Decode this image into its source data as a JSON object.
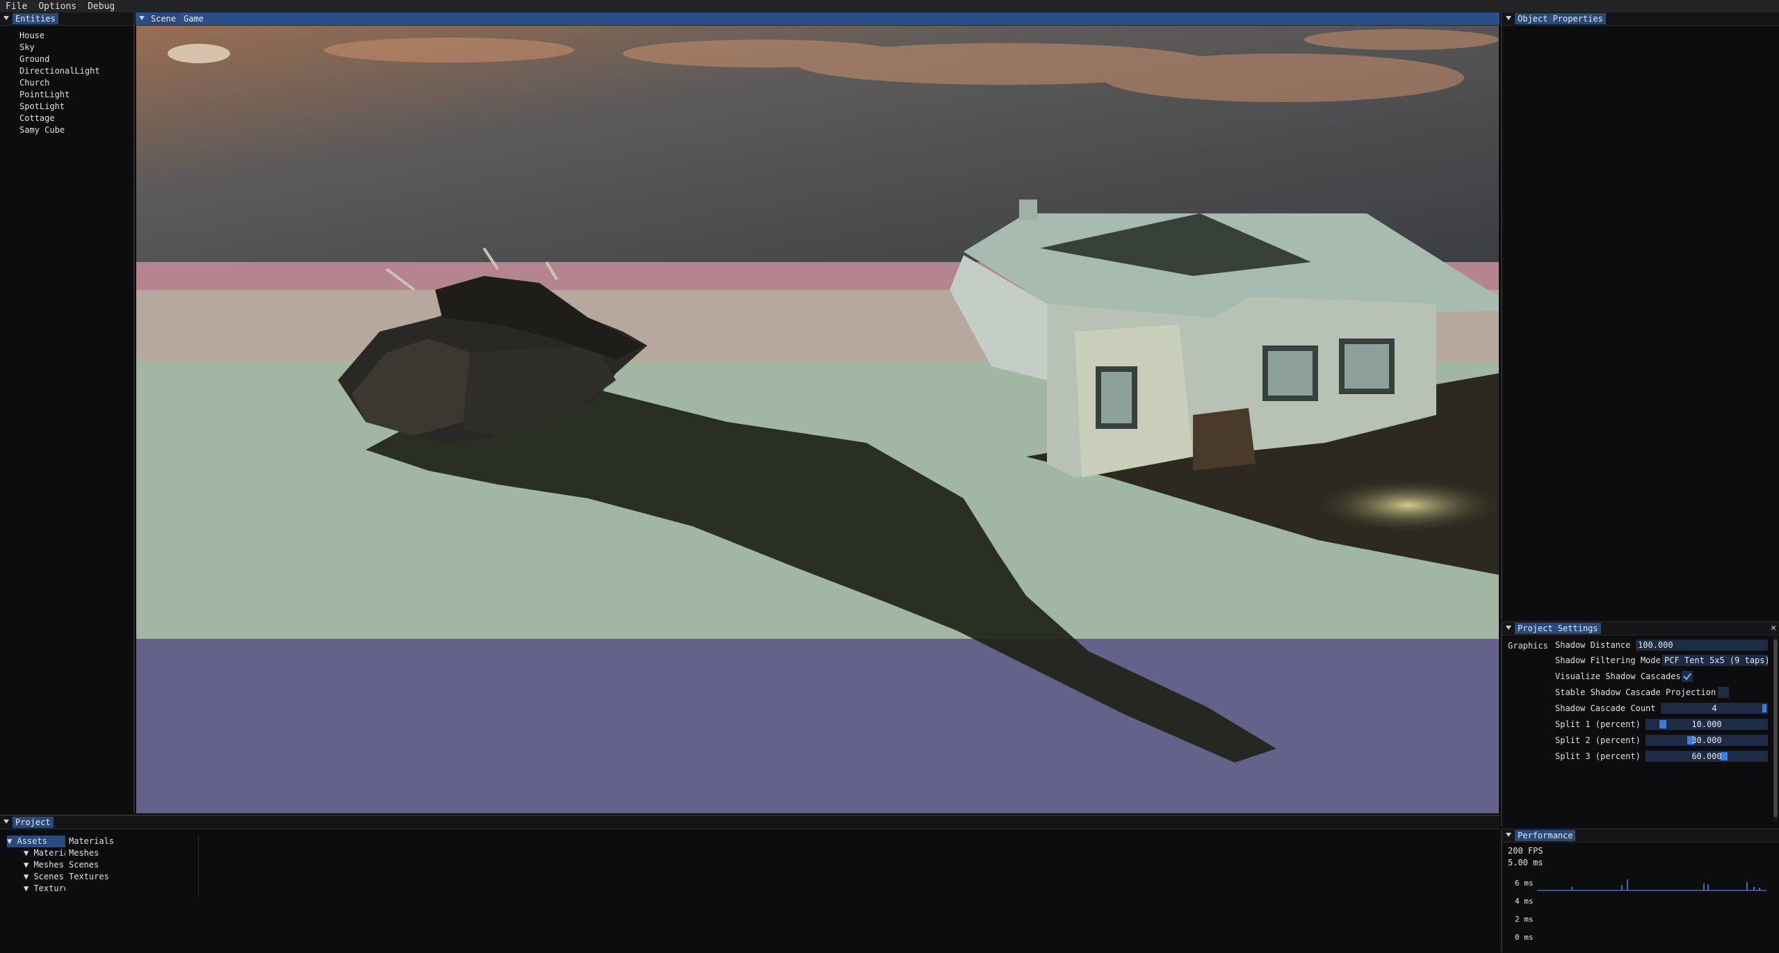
{
  "menu": {
    "file": "File",
    "options": "Options",
    "debug": "Debug"
  },
  "entities": {
    "title": "Entities",
    "items": [
      "House",
      "Sky",
      "Ground",
      "DirectionalLight",
      "Church",
      "PointLight",
      "SpotLight",
      "Cottage",
      "Samy Cube"
    ]
  },
  "scene": {
    "tab_scene": "Scene",
    "tab_game": "Game"
  },
  "object_properties": {
    "title": "Object Properties"
  },
  "project_settings": {
    "title": "Project Settings",
    "close": "✕",
    "section": "Graphics",
    "shadow_distance_label": "Shadow Distance",
    "shadow_distance_value": "100.000",
    "filtering_label": "Shadow Filtering Mode",
    "filtering_value": "PCF Tent 5x5 (9 taps)",
    "visualize_label": "Visualize Shadow Cascades",
    "visualize_checked": true,
    "stable_label": "Stable Shadow Cascade Projection",
    "stable_checked": false,
    "cascade_count_label": "Shadow Cascade Count",
    "cascade_count_value": "4",
    "split1_label": "Split 1 (percent)",
    "split1_value": "10.000",
    "split2_label": "Split 2 (percent)",
    "split2_value": "30.000",
    "split3_label": "Split 3 (percent)",
    "split3_value": "60.000"
  },
  "performance": {
    "title": "Performance",
    "fps": "200 FPS",
    "frame_time": "5.00 ms",
    "y_labels": [
      "6 ms",
      "4 ms",
      "2 ms",
      "0 ms"
    ]
  },
  "project": {
    "title": "Project",
    "tree_root": "Assets",
    "tree_children": [
      "Materials",
      "Meshes",
      "Scenes",
      "Textures"
    ],
    "folder_list": [
      "Materials",
      "Meshes",
      "Scenes",
      "Textures"
    ]
  },
  "colors": {
    "accent": "#294a7a",
    "slider_grab": "#3d7de0",
    "scene_header": "#2a4f86"
  }
}
